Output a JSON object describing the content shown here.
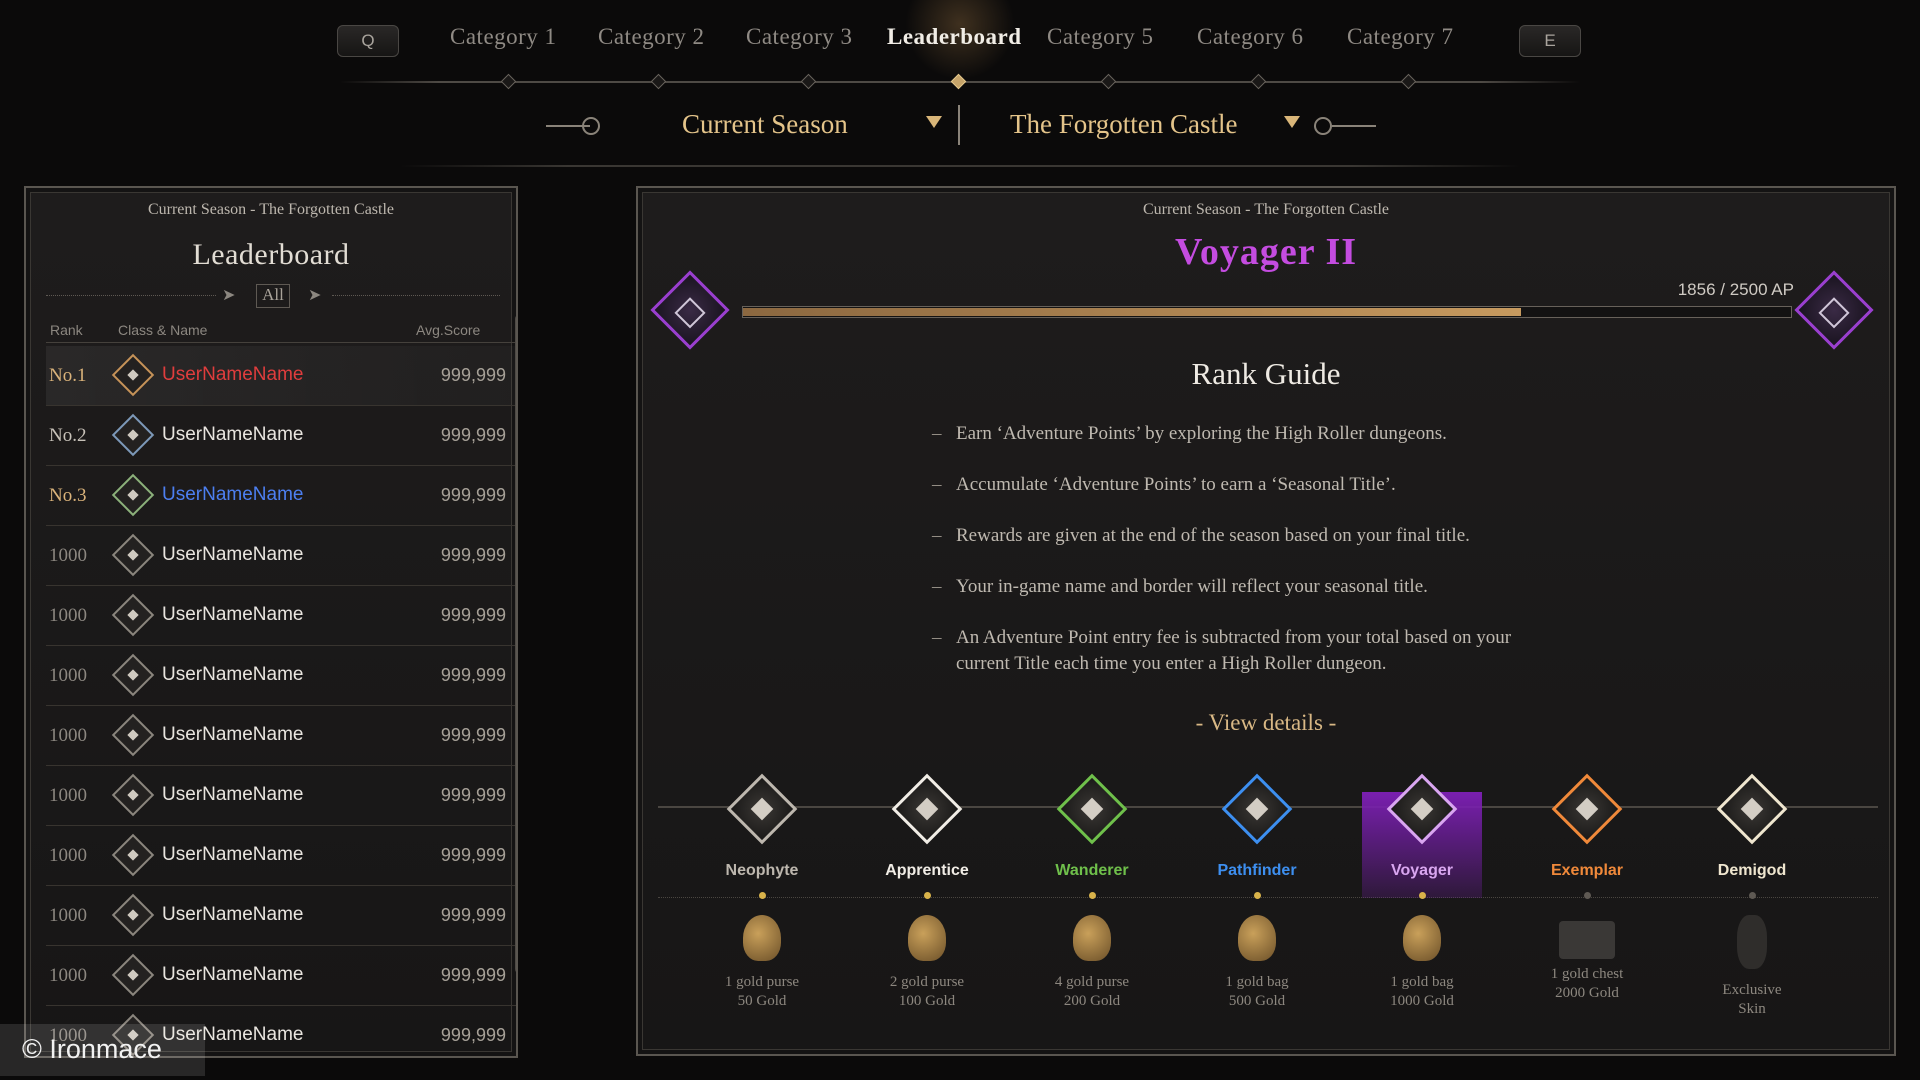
{
  "top_bar": {
    "left_key": "Q",
    "right_key": "E",
    "tabs": [
      {
        "label": "Category 1",
        "active": false
      },
      {
        "label": "Category 2",
        "active": false
      },
      {
        "label": "Category 3",
        "active": false
      },
      {
        "label": "Leaderboard",
        "active": true
      },
      {
        "label": "Category 5",
        "active": false
      },
      {
        "label": "Category 6",
        "active": false
      },
      {
        "label": "Category 7",
        "active": false
      }
    ]
  },
  "filters": {
    "season": "Current Season",
    "dungeon": "The Forgotten Castle"
  },
  "leaderboard": {
    "subtitle": "Current Season - The Forgotten Castle",
    "title": "Leaderboard",
    "filter_label": "All",
    "columns": {
      "rank": "Rank",
      "class_name": "Class & Name",
      "score": "Avg.Score"
    },
    "rows": [
      {
        "rank": "No.1",
        "name": "UserNameName",
        "score": "999,999",
        "name_color": "red"
      },
      {
        "rank": "No.2",
        "name": "UserNameName",
        "score": "999,999",
        "name_color": "white"
      },
      {
        "rank": "No.3",
        "name": "UserNameName",
        "score": "999,999",
        "name_color": "blue"
      },
      {
        "rank": "1000",
        "name": "UserNameName",
        "score": "999,999",
        "name_color": "white"
      },
      {
        "rank": "1000",
        "name": "UserNameName",
        "score": "999,999",
        "name_color": "white"
      },
      {
        "rank": "1000",
        "name": "UserNameName",
        "score": "999,999",
        "name_color": "white"
      },
      {
        "rank": "1000",
        "name": "UserNameName",
        "score": "999,999",
        "name_color": "white"
      },
      {
        "rank": "1000",
        "name": "UserNameName",
        "score": "999,999",
        "name_color": "white"
      },
      {
        "rank": "1000",
        "name": "UserNameName",
        "score": "999,999",
        "name_color": "white"
      },
      {
        "rank": "1000",
        "name": "UserNameName",
        "score": "999,999",
        "name_color": "white"
      },
      {
        "rank": "1000",
        "name": "UserNameName",
        "score": "999,999",
        "name_color": "white"
      },
      {
        "rank": "1000",
        "name": "UserNameName",
        "score": "999,999",
        "name_color": "white"
      }
    ]
  },
  "rank_panel": {
    "subtitle": "Current Season - The Forgotten Castle",
    "current_title": "Voyager II",
    "ap_text": "1856 / 2500 AP",
    "ap_current": 1856,
    "ap_max": 2500,
    "guide_title": "Rank Guide",
    "guide_items": [
      "Earn ‘Adventure Points’ by exploring the High Roller dungeons.",
      "Accumulate ‘Adventure Points’ to earn a ‘Seasonal Title’.",
      "Rewards are given at the end of the season based on your final title.",
      "Your in-game name and border will reflect your seasonal title.",
      "An Adventure Point entry fee is subtracted from your total based on your current Title each time you enter a High Roller dungeon."
    ],
    "view_details": "- View details -",
    "tiers": [
      {
        "name": "Neophyte",
        "color": "#bdb7ae",
        "reward_line1": "1 gold purse",
        "reward_line2": "50 Gold",
        "reward": "purse",
        "reached": true
      },
      {
        "name": "Apprentice",
        "color": "#f1ede6",
        "reward_line1": "2 gold purse",
        "reward_line2": "100 Gold",
        "reward": "purse",
        "reached": true
      },
      {
        "name": "Wanderer",
        "color": "#6fc04b",
        "reward_line1": "4 gold purse",
        "reward_line2": "200 Gold",
        "reward": "purse",
        "reached": true
      },
      {
        "name": "Pathfinder",
        "color": "#3d8ff0",
        "reward_line1": "1 gold bag",
        "reward_line2": "500 Gold",
        "reward": "bag",
        "reached": true
      },
      {
        "name": "Voyager",
        "color": "#d9a6f0",
        "reward_line1": "1 gold bag",
        "reward_line2": "1000 Gold",
        "reward": "bag",
        "reached": true,
        "current": true
      },
      {
        "name": "Exemplar",
        "color": "#f0893a",
        "reward_line1": "1 gold chest",
        "reward_line2": "2000 Gold",
        "reward": "chest",
        "reached": false
      },
      {
        "name": "Demigod",
        "color": "#efe6cf",
        "reward_line1": "Exclusive",
        "reward_line2": "Skin",
        "reward": "skin",
        "reached": false
      }
    ]
  },
  "watermark": "© Ironmace",
  "colors": {
    "accent_gold": "#d9b679",
    "voyager_purple": "#c44ce0",
    "rank1_name": "#e03d3d",
    "rank3_name": "#4d7ff0"
  }
}
